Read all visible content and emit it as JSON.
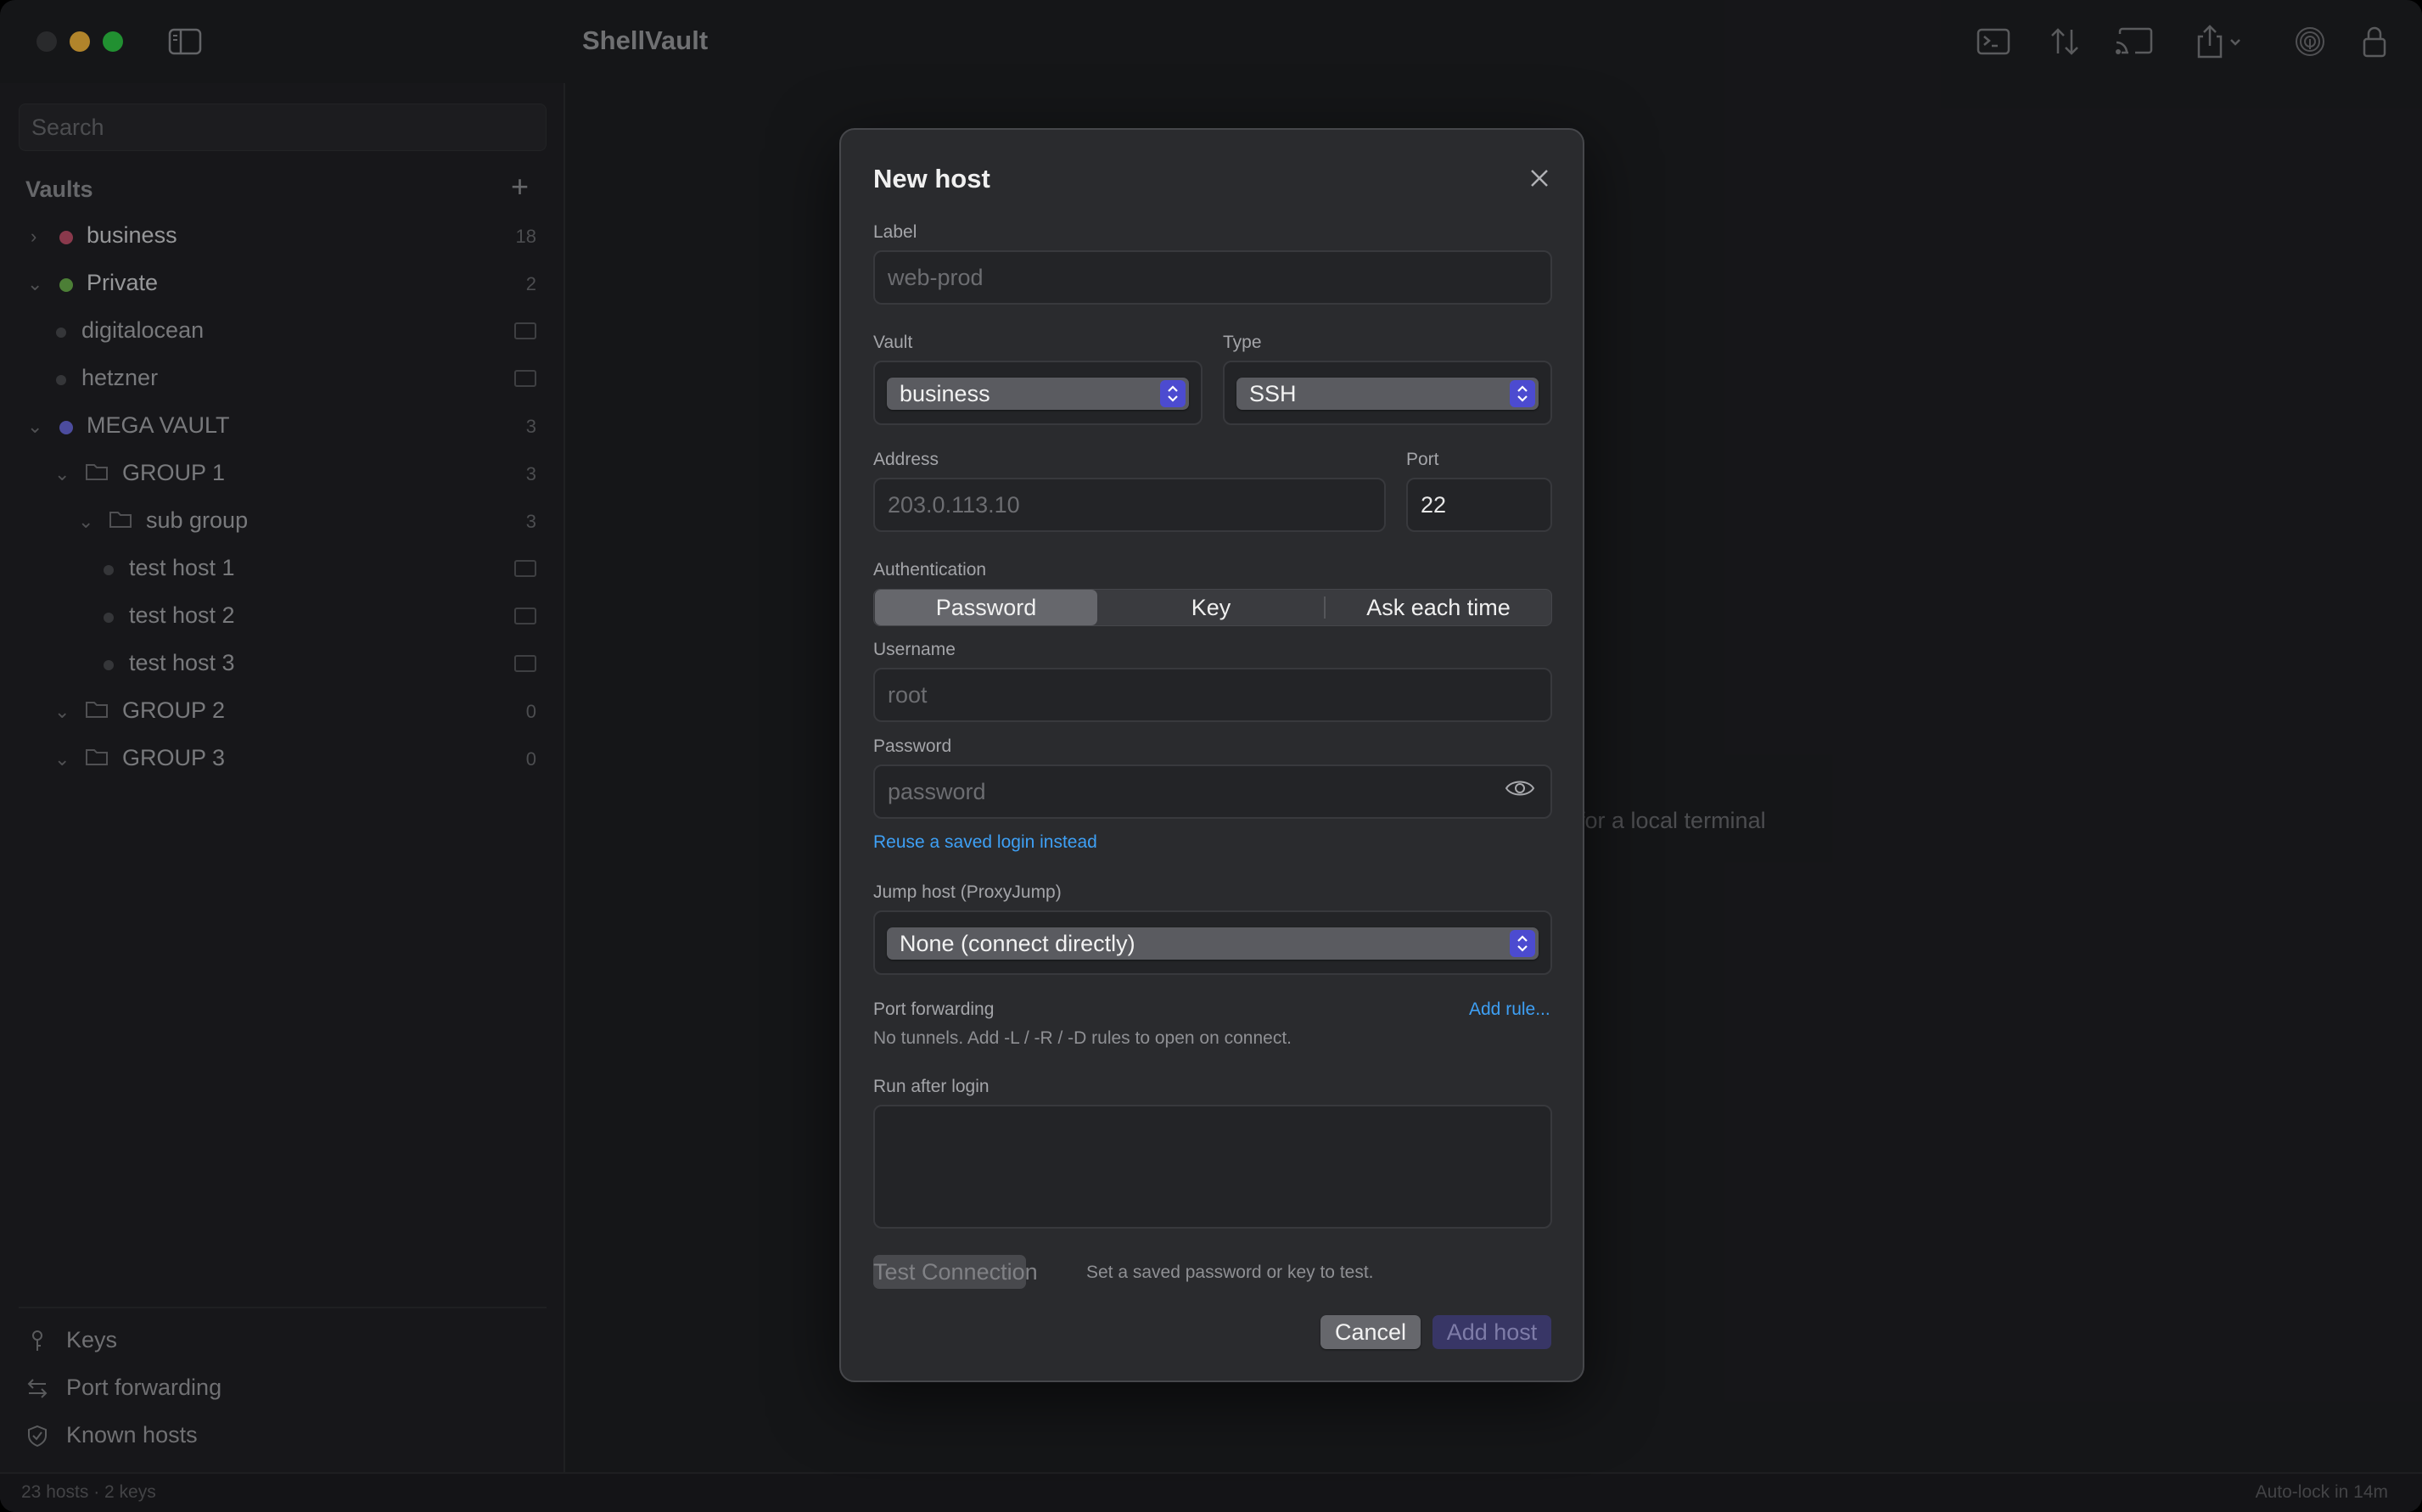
{
  "app": {
    "title": "ShellVault"
  },
  "toolbar": {
    "icons": [
      "terminal-icon",
      "transfer-icon",
      "cast-icon",
      "share-icon",
      "fingerprint-icon",
      "lock-icon"
    ]
  },
  "sidebar": {
    "search_placeholder": "Search",
    "vaults_header": "Vaults",
    "tree": [
      {
        "label": "business",
        "count": "18",
        "color": "#c0506a",
        "expanded": false
      },
      {
        "label": "Private",
        "count": "2",
        "color": "#6ab04c",
        "expanded": true
      },
      {
        "label": "digitalocean"
      },
      {
        "label": "hetzner"
      },
      {
        "label": "MEGA VAULT",
        "count": "3",
        "color": "#6a6adc",
        "expanded": true
      },
      {
        "label": "GROUP 1",
        "count": "3"
      },
      {
        "label": "sub group",
        "count": "3"
      },
      {
        "label": "test host 1"
      },
      {
        "label": "test host 2"
      },
      {
        "label": "test host 3"
      },
      {
        "label": "GROUP 2",
        "count": "0"
      },
      {
        "label": "GROUP 3",
        "count": "0"
      }
    ],
    "footer": [
      {
        "label": "Keys",
        "icon": "key-icon"
      },
      {
        "label": "Port forwarding",
        "icon": "arrows-icon"
      },
      {
        "label": "Known hosts",
        "icon": "shield-check-icon"
      }
    ]
  },
  "main": {
    "hint": "for a local terminal"
  },
  "statusbar": {
    "left": "23 hosts · 2 keys",
    "right": "Auto-lock in 14m"
  },
  "dialog": {
    "title": "New host",
    "label_field": {
      "label": "Label",
      "placeholder": "web-prod"
    },
    "vault_field": {
      "label": "Vault",
      "value": "business"
    },
    "type_field": {
      "label": "Type",
      "value": "SSH"
    },
    "address_field": {
      "label": "Address",
      "placeholder": "203.0.113.10"
    },
    "port_field": {
      "label": "Port",
      "value": "22"
    },
    "auth": {
      "label": "Authentication",
      "options": [
        "Password",
        "Key",
        "Ask each time"
      ],
      "selected": "Password"
    },
    "username_field": {
      "label": "Username",
      "placeholder": "root"
    },
    "password_field": {
      "label": "Password",
      "placeholder": "password"
    },
    "reuse_link": "Reuse a saved login instead",
    "jump_field": {
      "label": "Jump host (ProxyJump)",
      "value": "None (connect directly)"
    },
    "port_forwarding": {
      "label": "Port forwarding",
      "add_link": "Add rule...",
      "hint": "No tunnels. Add -L / -R / -D rules to open on connect."
    },
    "run_after": {
      "label": "Run after login"
    },
    "test_button": "Test Connection",
    "test_hint": "Set a saved password or key to test.",
    "cancel_button": "Cancel",
    "add_button": "Add host"
  }
}
